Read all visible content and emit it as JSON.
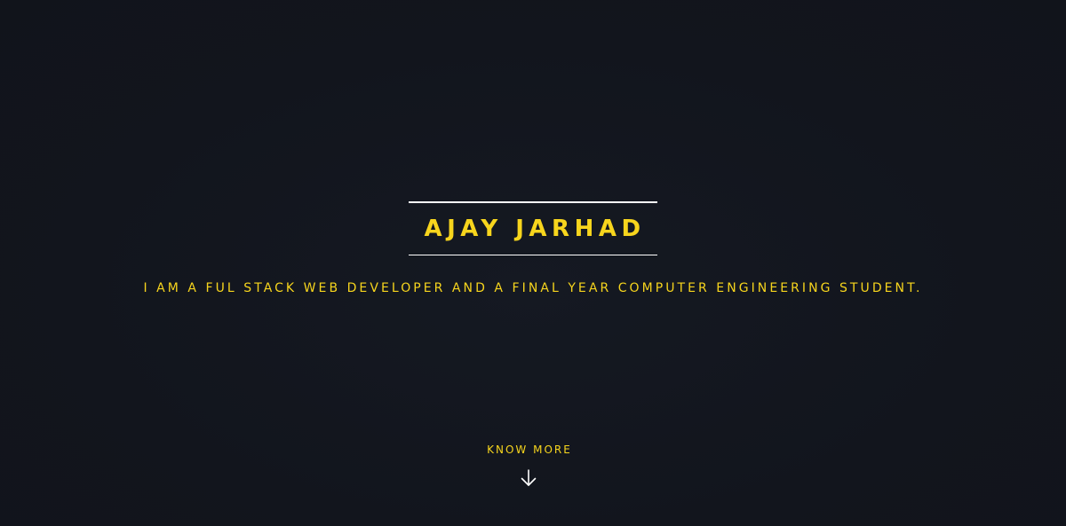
{
  "hero": {
    "name": "AJAY JARHAD",
    "tagline": "I AM A FUL STACK WEB DEVELOPER AND A FINAL YEAR COMPUTER ENGINEERING STUDENT.",
    "cta_label": "KNOW MORE",
    "cta_icon": "arrow-down-icon"
  },
  "colors": {
    "background": "#13161f",
    "accent": "#f7d51d",
    "rule": "#ffffff"
  }
}
